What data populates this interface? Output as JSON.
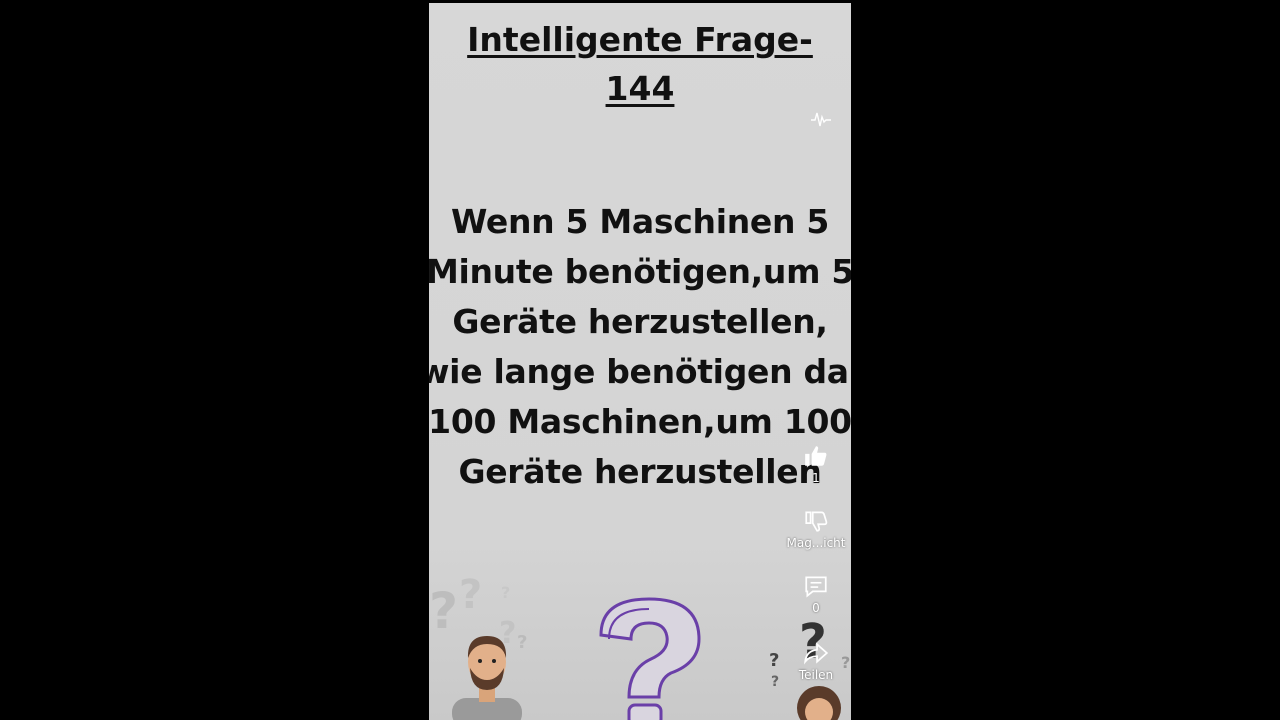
{
  "video": {
    "title_line1": "Intelligente Frage-",
    "title_line2": "144",
    "question_lines": [
      "Wenn 5 Maschinen 5",
      "Minute benötigen,um 5",
      "Geräte herzustellen,",
      "wie lange benötigen dann",
      "100 Maschinen,um 100",
      "Geräte herzustellen"
    ]
  },
  "actions": {
    "like_count": "1",
    "dislike_label": "Mag...icht",
    "comment_count": "0",
    "share_label": "Teilen"
  },
  "icons": {
    "like": "thumbs-up-icon",
    "dislike": "thumbs-down-icon",
    "comment": "comment-icon",
    "share": "share-icon",
    "pulse": "audio-pulse-icon"
  },
  "colors": {
    "background": "#000000",
    "video_bg": "#d6d6d6",
    "text": "#111111",
    "question_mark_accent": "#6a3fa8"
  }
}
